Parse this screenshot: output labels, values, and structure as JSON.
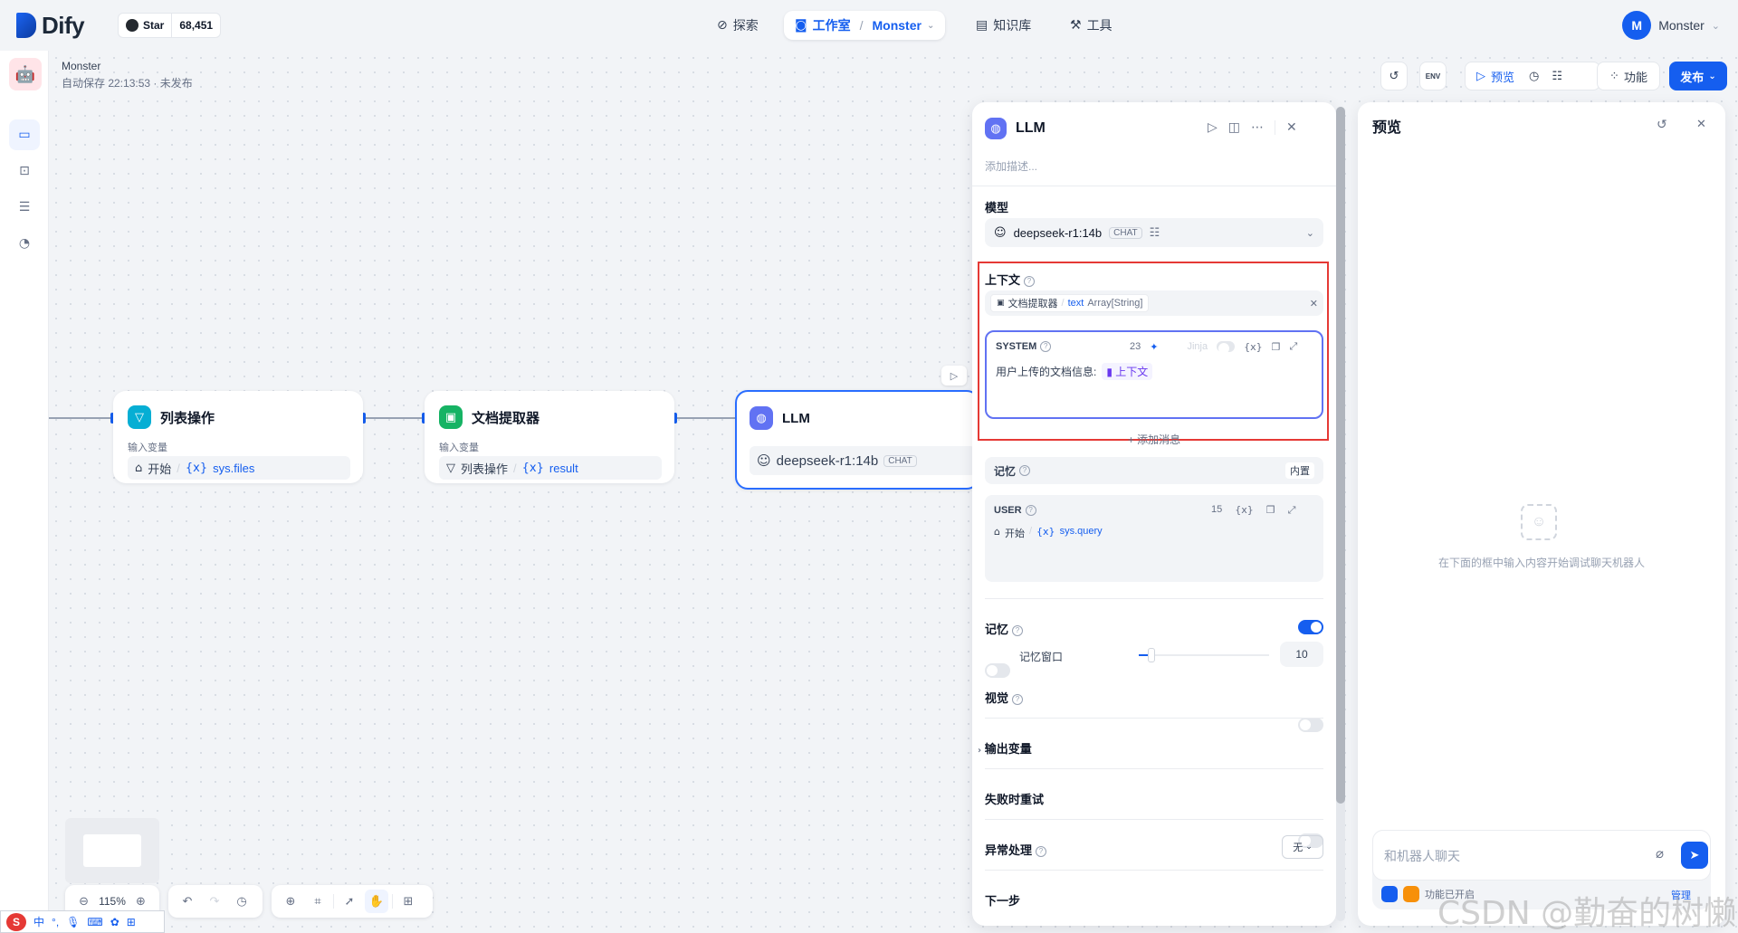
{
  "brand": {
    "name": "Dify"
  },
  "github": {
    "star_label": "Star",
    "star_count": "68,451"
  },
  "nav": {
    "explore": "探索",
    "studio": "工作室",
    "studio_app": "Monster",
    "knowledge": "知识库",
    "tools": "工具"
  },
  "user": {
    "initial": "M",
    "name": "Monster"
  },
  "app": {
    "name": "Monster",
    "status": "自动保存 22:13:53 · 未发布"
  },
  "header_buttons": {
    "preview": "预览",
    "features": "功能",
    "publish": "发布",
    "env": "ENV"
  },
  "nodes": {
    "list_op": {
      "title": "列表操作",
      "sub": "输入变量",
      "source": "开始",
      "var": "sys.files"
    },
    "doc_extract": {
      "title": "文档提取器",
      "sub": "输入变量",
      "source": "列表操作",
      "var": "result"
    },
    "llm": {
      "title": "LLM",
      "model": "deepseek-r1:14b",
      "badge": "CHAT"
    }
  },
  "llm_panel": {
    "title": "LLM",
    "desc_placeholder": "添加描述...",
    "model_label": "模型",
    "model_name": "deepseek-r1:14b",
    "model_badge": "CHAT",
    "context_label": "上下文",
    "context_source": "文档提取器",
    "context_var": "text",
    "context_type": "Array[String]",
    "system_label": "SYSTEM",
    "system_count": "23",
    "jinja": "Jinja",
    "var_token": "{x}",
    "system_text": "用户上传的文档信息:",
    "system_ctx_chip": "上下文",
    "add_message": "+ 添加消息",
    "memory_label": "记忆",
    "memory_builtin": "内置",
    "user_label": "USER",
    "user_count": "15",
    "user_source": "开始",
    "user_var": "sys.query",
    "memory2_label": "记忆",
    "memory_window_label": "记忆窗口",
    "memory_window_value": "10",
    "memory_window_fraction": 0.1,
    "vision_label": "视觉",
    "output_vars_label": "输出变量",
    "retry_label": "失败时重试",
    "error_label": "异常处理",
    "error_value": "无",
    "next_step_label": "下一步"
  },
  "preview_panel": {
    "title": "预览",
    "empty_hint": "在下面的框中输入内容开始调试聊天机器人",
    "chat_placeholder": "和机器人聊天",
    "features_status": "功能已开启",
    "manage": "管理"
  },
  "bottom_bar": {
    "zoom": "115%"
  },
  "ime": {
    "lang": "中",
    "punct": "°,"
  },
  "watermark": "CSDN @勤奋的树懒",
  "colors": {
    "accent": "#155eef",
    "highlight_border": "#e53935",
    "canvas_bg": "#f2f4f7"
  }
}
